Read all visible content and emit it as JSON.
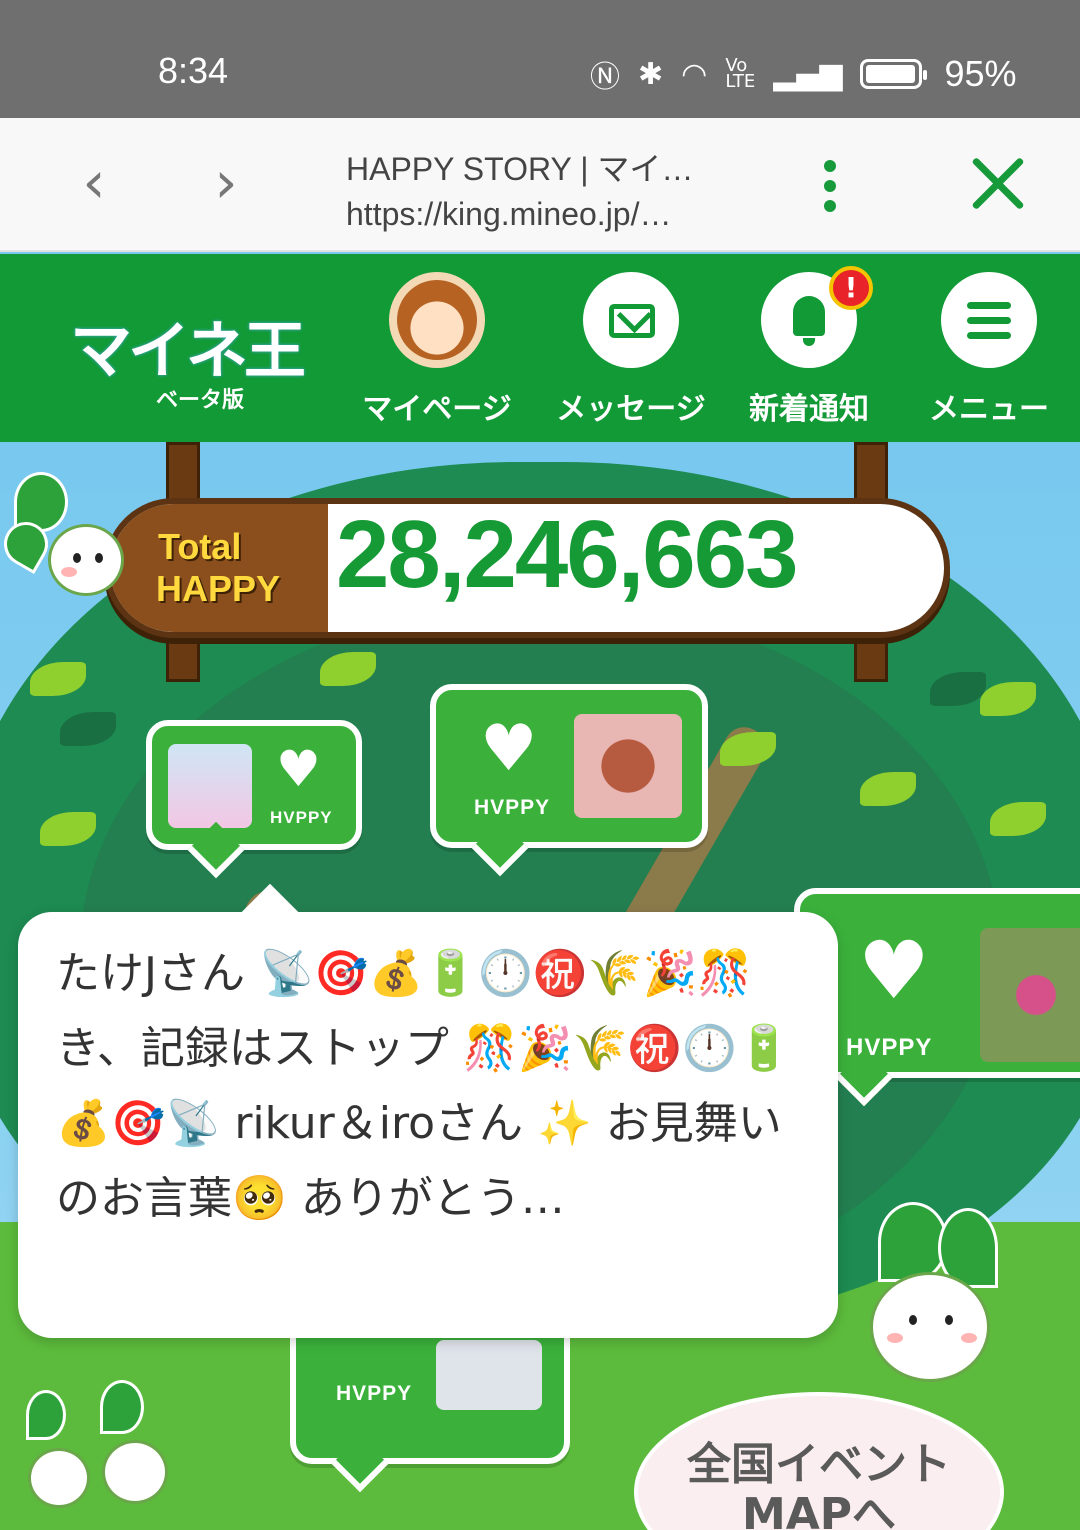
{
  "status_bar": {
    "time": "8:34",
    "battery_percent": "95%",
    "icons": [
      "nfc-icon",
      "bluetooth-icon",
      "wifi-icon",
      "volte-icon",
      "signal-icon",
      "battery-icon"
    ]
  },
  "browser": {
    "title": "HAPPY STORY | マイ…",
    "url": "https://king.mineo.jp/…"
  },
  "header": {
    "logo_text": "マイネ王",
    "logo_sub": "ベータ版",
    "items": [
      {
        "label": "マイページ",
        "icon": "avatar"
      },
      {
        "label": "メッセージ",
        "icon": "mail-icon"
      },
      {
        "label": "新着通知",
        "icon": "bell-icon",
        "badge": "!"
      },
      {
        "label": "メニュー",
        "icon": "menu-icon"
      }
    ]
  },
  "total_sign": {
    "label_line1": "Total",
    "label_line2": "HAPPY",
    "value": "28,246,663"
  },
  "bubbles": {
    "happy_label": "HVPPY"
  },
  "popup": {
    "text": "たけJさん 📡🎯💰🔋🕛㊗️🌾🎉🎊 き、記録はストップ 🎊🎉🌾㊗️🕛🔋💰🎯📡 rikur＆iroさん ✨ お見舞いのお言葉🥺 ありがとう…"
  },
  "event_button": {
    "line1": "全国イベント",
    "line2": "MAPへ"
  },
  "colors": {
    "brand_green": "#119a36",
    "bubble_green": "#3bb13b",
    "sky": "#79c9ee",
    "wood": "#8a4f1d",
    "sign_text": "#ffd93d"
  }
}
